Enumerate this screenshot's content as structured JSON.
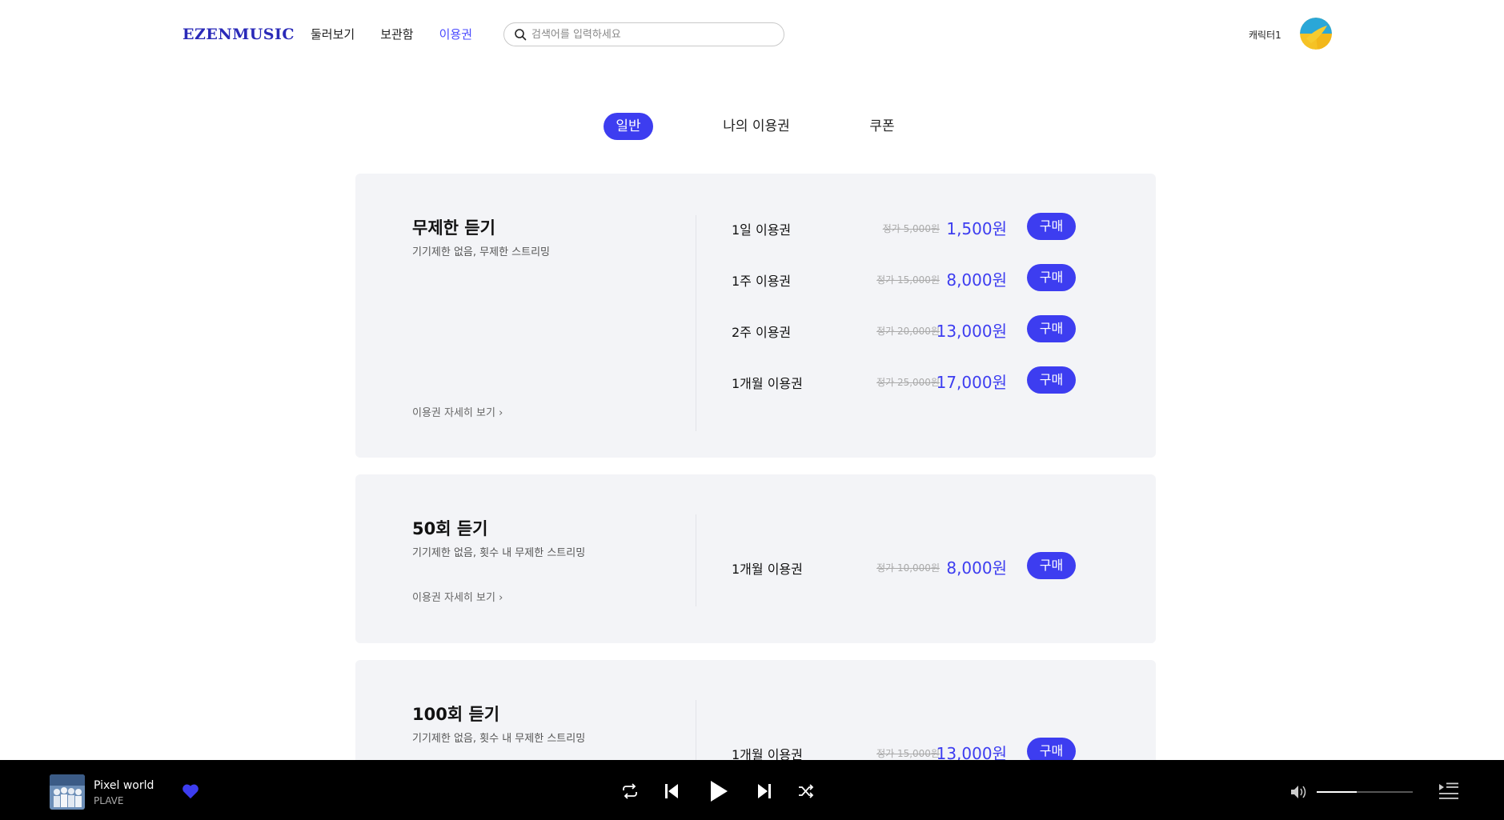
{
  "header": {
    "logo": "EZENMUSIC",
    "nav": [
      {
        "label": "둘러보기"
      },
      {
        "label": "보관함"
      },
      {
        "label": "이용권"
      }
    ],
    "search_placeholder": "검색어를 입력하세요",
    "user_name": "캐릭터1"
  },
  "tabs": [
    {
      "label": "일반",
      "active": true
    },
    {
      "label": "나의 이용권"
    },
    {
      "label": "쿠폰"
    }
  ],
  "cards": [
    {
      "title": "무제한 듣기",
      "desc": "기기제한 없음, 무제한 스트리밍",
      "detail_link": "이용권 자세히 보기",
      "products": [
        {
          "name": "1일 이용권",
          "original": "정가 5,000원",
          "price": "1,500원",
          "buy": "구매"
        },
        {
          "name": "1주 이용권",
          "original": "정가 15,000원",
          "price": "8,000원",
          "buy": "구매"
        },
        {
          "name": "2주 이용권",
          "original": "정가 20,000원",
          "price": "13,000원",
          "buy": "구매"
        },
        {
          "name": "1개월 이용권",
          "original": "정가 25,000원",
          "price": "17,000원",
          "buy": "구매"
        }
      ]
    },
    {
      "title": "50회 듣기",
      "desc": "기기제한 없음, 횟수 내 무제한 스트리밍",
      "detail_link": "이용권 자세히 보기",
      "products": [
        {
          "name": "1개월 이용권",
          "original": "정가 10,000원",
          "price": "8,000원",
          "buy": "구매"
        }
      ]
    },
    {
      "title": "100회 듣기",
      "desc": "기기제한 없음, 횟수 내 무제한 스트리밍",
      "products": [
        {
          "name": "1개월 이용권",
          "original": "정가 15,000원",
          "price": "13,000원",
          "buy": "구매"
        }
      ]
    }
  ],
  "player": {
    "track_title": "Pixel world",
    "artist": "PLAVE",
    "liked": true,
    "volume": 0.42
  },
  "colors": {
    "accent": "#3d3df0",
    "card_bg": "#f3f4f7",
    "player_bg": "#000000"
  }
}
